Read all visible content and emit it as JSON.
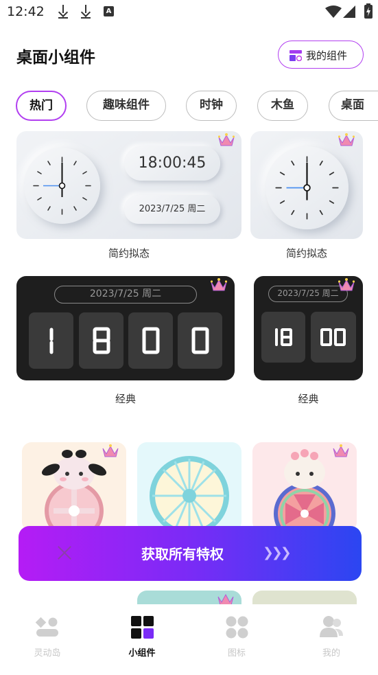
{
  "status_bar": {
    "time": "12:42",
    "a_label": "A"
  },
  "header": {
    "title": "桌面小组件",
    "my_widgets_label": "我的组件"
  },
  "tabs": [
    {
      "label": "热门",
      "active": true
    },
    {
      "label": "趣味组件",
      "active": false
    },
    {
      "label": "时钟",
      "active": false
    },
    {
      "label": "木鱼",
      "active": false
    },
    {
      "label": "桌面",
      "active": false
    }
  ],
  "widgets": {
    "neu_large": {
      "time": "18:00:45",
      "date": "2023/7/25 周二",
      "caption": "简约拟态"
    },
    "neu_small": {
      "caption": "简约拟态"
    },
    "classic_large": {
      "date": "2023/7/25 周二",
      "digits": [
        "1",
        "8",
        "0",
        "0"
      ],
      "caption": "经典"
    },
    "classic_small": {
      "date": "2023/7/25 周二",
      "pair1": "18",
      "pair2": "00",
      "caption": "经典"
    }
  },
  "banner": {
    "label": "获取所有特权",
    "arrows": "❯❯❯"
  },
  "nav": [
    {
      "label": "灵动岛",
      "icon": "dynamic-island-icon",
      "active": false
    },
    {
      "label": "小组件",
      "icon": "widgets-icon",
      "active": true
    },
    {
      "label": "图标",
      "icon": "icons-grid-icon",
      "active": false
    },
    {
      "label": "我的",
      "icon": "profile-icon",
      "active": false
    }
  ],
  "colors": {
    "accent": "#b13ef0",
    "banner_start": "#b51cf5",
    "banner_end": "#2b46f2",
    "crown": "#f08ab0"
  }
}
